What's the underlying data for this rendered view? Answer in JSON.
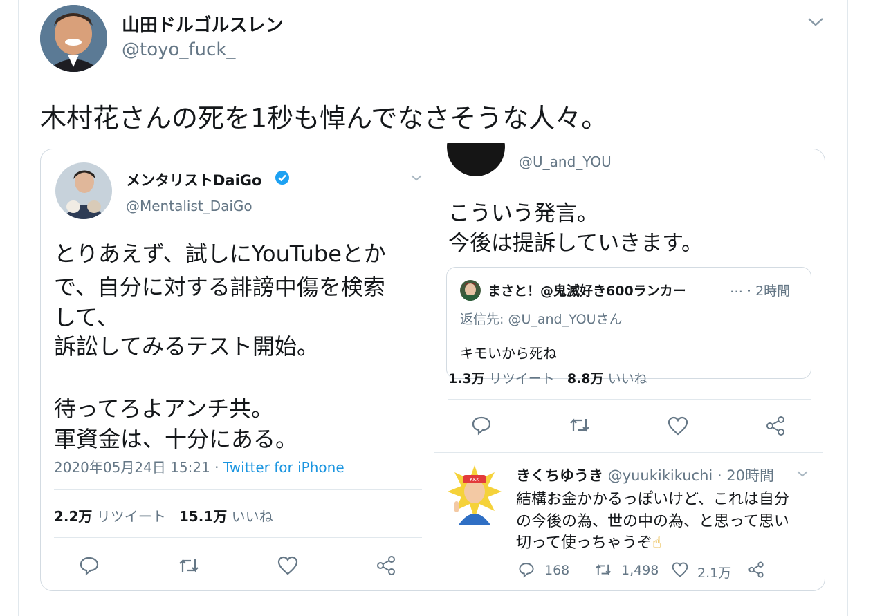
{
  "outer_tweet": {
    "display_name": "山田ドルゴルスレン",
    "handle": "@toyo_fuck_",
    "text": "木村花さんの死を1秒も悼んでなさそうな人々。"
  },
  "left_tweet": {
    "display_name": "メンタリストDaiGo",
    "handle": "@Mentalist_DaiGo",
    "text_lines": [
      "とりあえず、試しにYouTubeとか",
      "で、自分に対する誹謗中傷を検索",
      "して、",
      "訴訟してみるテスト開始。",
      "",
      "待ってろよアンチ共。",
      "軍資金は、十分にある。"
    ],
    "date": "2020年05月24日 15:21",
    "separator": " · ",
    "client": "Twitter for iPhone",
    "retweet_count": "2.2万",
    "retweet_label": "リツイート",
    "like_count": "15.1万",
    "like_label": "いいね"
  },
  "right_tweet": {
    "handle": "@U_and_YOU",
    "text_lines": [
      "こういう発言。",
      "今後は提訴していきます。"
    ],
    "retweet_count": "1.3万",
    "retweet_label": "リツイート",
    "like_count": "8.8万",
    "like_label": "いいね"
  },
  "quoted_tweet": {
    "name": "まさと！@鬼滅好き600ランカー",
    "ellipsis": "…",
    "time": "· 2時間",
    "reply_to": "返信先: @U_and_YOUさん",
    "text": "キモいから死ね"
  },
  "reply_tweet": {
    "display_name": "きくちゆうき",
    "handle": "@yuukikikuchi",
    "time": "· 20時間",
    "text_lines": [
      "結構お金かかるっぽいけど、これは自分",
      "の今後の為、世の中の為、と思って思い",
      "切って使っちゃうぞ"
    ],
    "emoji": "☝",
    "reply_count": "168",
    "retweet_count": "1,498",
    "like_count": "2.1万"
  },
  "colors": {
    "verified": "#1da1f2",
    "link": "#1b95e0",
    "muted": "#657786",
    "border": "#e1e8ed"
  }
}
